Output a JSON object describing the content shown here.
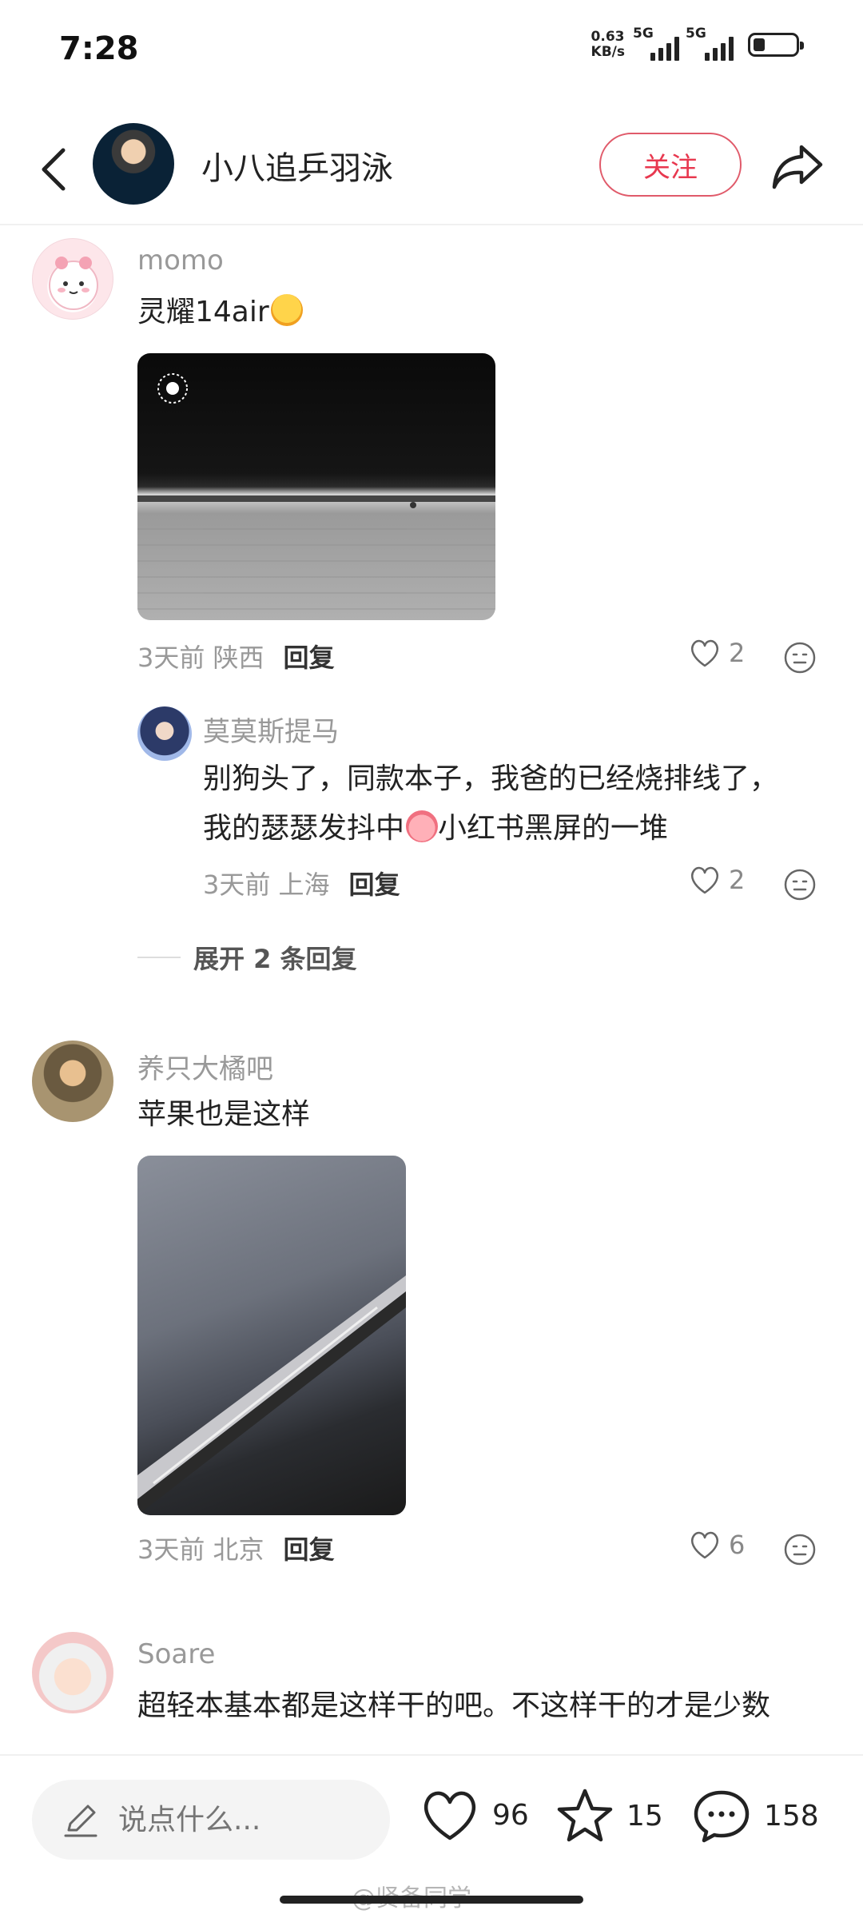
{
  "status_bar": {
    "time": "7:28",
    "net_speed_value": "0.63",
    "net_speed_unit": "KB/s",
    "signal1_label": "5G",
    "signal2_label": "5G"
  },
  "header": {
    "author_name": "小八追乒羽泳",
    "follow_label": "关注"
  },
  "comments": [
    {
      "username": "momo",
      "text": "灵耀14air",
      "time_location": "3天前 陕西",
      "reply_label": "回复",
      "likes": "2",
      "replies": [
        {
          "username": "莫莫斯提马",
          "text_line1": "别狗头了，同款本子，我爸的已经烧排线了，",
          "text_line2a": "我的瑟瑟发抖中",
          "text_line2b": "小红书黑屏的一堆",
          "time_location": "3天前 上海",
          "reply_label": "回复",
          "likes": "2"
        }
      ],
      "expand_label": "展开 2 条回复"
    },
    {
      "username": "养只大橘吧",
      "text": "苹果也是这样",
      "time_location": "3天前 北京",
      "reply_label": "回复",
      "likes": "6"
    },
    {
      "username": "Soare",
      "text": "超轻本基本都是这样干的吧。不这样干的才是少数"
    }
  ],
  "bottom_bar": {
    "input_placeholder": "说点什么...",
    "likes_count": "96",
    "collects_count": "15",
    "comments_count": "158"
  },
  "watermark": "@贤备同学",
  "colors": {
    "accent": "#e8384f",
    "muted_text": "#999999",
    "text": "#222222"
  }
}
